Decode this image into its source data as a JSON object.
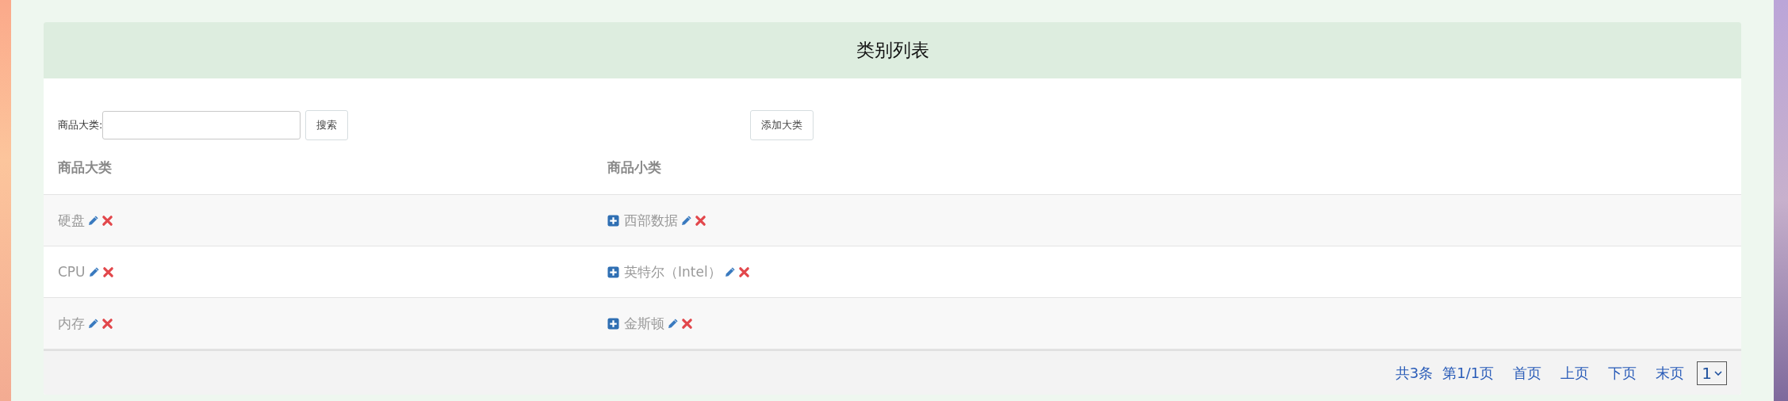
{
  "title": "类别列表",
  "search": {
    "label": "商品大类:",
    "button": "搜索"
  },
  "add_button": "添加大类",
  "columns": [
    "商品大类",
    "商品小类"
  ],
  "rows": [
    {
      "category": "硬盘",
      "subcategories": [
        "西部数据"
      ]
    },
    {
      "category": "CPU",
      "subcategories": [
        "英特尔（Intel）"
      ]
    },
    {
      "category": "内存",
      "subcategories": [
        "金斯顿"
      ]
    }
  ],
  "pagination": {
    "total": "共3条",
    "page_info": "第1/1页",
    "first": "首页",
    "prev": "上页",
    "next": "下页",
    "last": "末页",
    "page_select": "1"
  }
}
